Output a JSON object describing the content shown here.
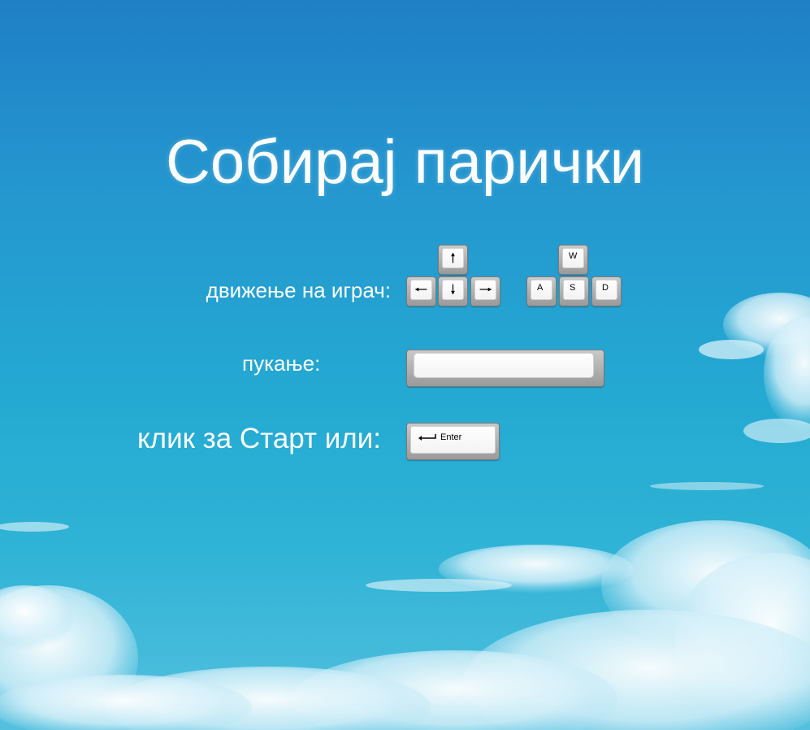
{
  "game": {
    "title": "Собирај парички"
  },
  "controls": {
    "move_label": "движење на играч:",
    "shoot_label": "пукање:",
    "start_label": "клик за Старт или:",
    "arrow_keys": [
      "up",
      "left",
      "down",
      "right"
    ],
    "wasd_keys": {
      "w": "W",
      "a": "A",
      "s": "S",
      "d": "D"
    },
    "enter_key": "Enter"
  },
  "colors": {
    "sky_top": "#1f7fc6",
    "sky_mid": "#24aad2",
    "text": "#ffffff"
  }
}
